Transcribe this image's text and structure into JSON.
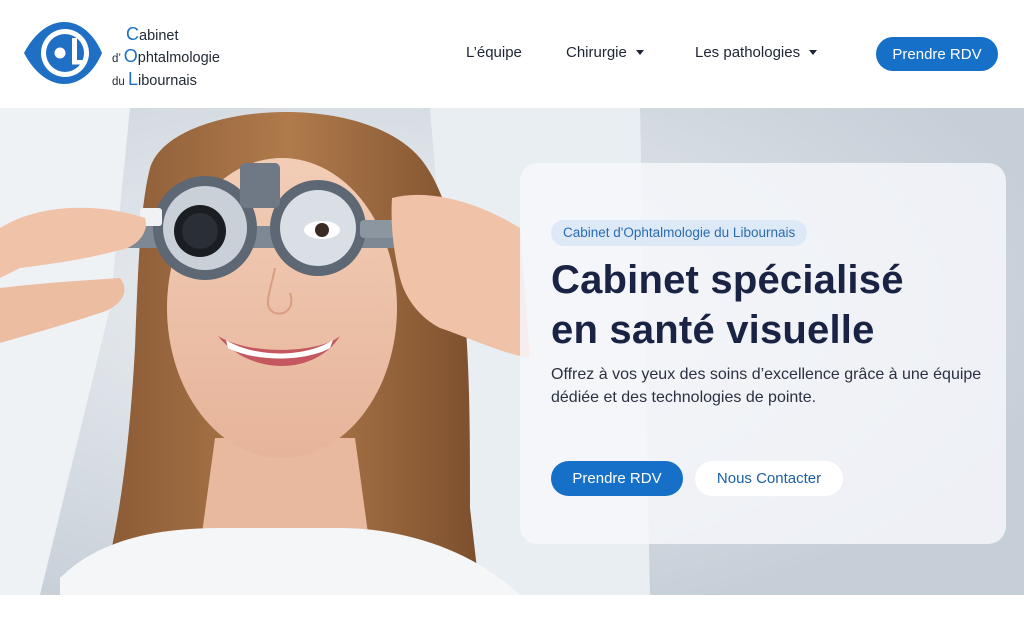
{
  "logo": {
    "line1_initial": "C",
    "line1_rest": "abinet",
    "line2_prefix": "d’ ",
    "line2_initial": "O",
    "line2_rest": "phtalmologie",
    "line3_prefix": "du ",
    "line3_initial": "L",
    "line3_rest": "ibournais",
    "accent_color": "#1f6fc4"
  },
  "nav": {
    "items": [
      {
        "label": "L’équipe",
        "has_dropdown": false
      },
      {
        "label": "Chirurgie",
        "has_dropdown": true
      },
      {
        "label": "Les pathologies",
        "has_dropdown": true
      }
    ],
    "cta_label": "Prendre RDV"
  },
  "hero": {
    "badge": "Cabinet d'Ophtalmologie du Libournais",
    "title_line1": "Cabinet spécialisé",
    "title_line2": "en santé visuelle",
    "description": "Offrez à vos yeux des soins d’excellence grâce à une équipe dédiée et des technologies de pointe.",
    "primary_button": "Prendre RDV",
    "secondary_button": "Nous Contacter",
    "image_subject": "smiling-woman-with-trial-frame-glasses"
  },
  "colors": {
    "primary": "#1670c8",
    "title": "#1b2345",
    "badge_bg": "#dde9f6"
  }
}
